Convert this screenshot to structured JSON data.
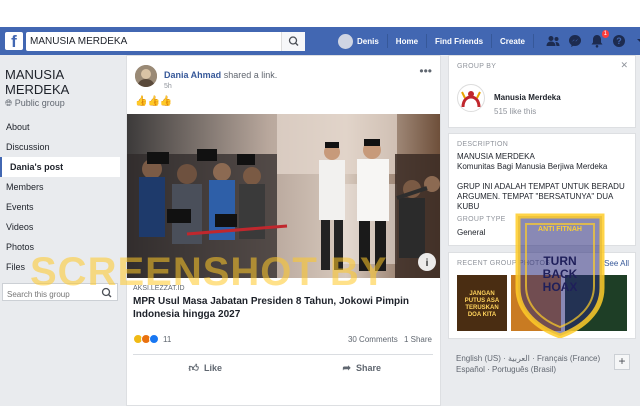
{
  "topbar": {
    "search_value": "MANUSIA MERDEKA",
    "user_name": "Denis",
    "home": "Home",
    "find_friends": "Find Friends",
    "create": "Create",
    "notif_count": "1",
    "brand_color": "#4267b2"
  },
  "group": {
    "name_line1": "MANUSIA",
    "name_line2": "MERDEKA",
    "privacy": "Public group"
  },
  "left_nav": {
    "items": [
      "About",
      "Discussion",
      "Dania's post",
      "Members",
      "Events",
      "Videos",
      "Photos",
      "Files"
    ],
    "active_index": 2,
    "search_placeholder": "Search this group"
  },
  "post": {
    "author": "Dania Ahmad",
    "action": "shared a link.",
    "time": "5h",
    "emoji": "👍👍👍",
    "link_source": "AKSI.LEZZAT.ID",
    "link_title": "MPR Usul Masa Jabatan Presiden 8 Tahun, Jokowi Pimpin Indonesia hingga 2027",
    "reaction_count": "11",
    "comments": "30 Comments",
    "shares": "1 Share",
    "like_label": "Like",
    "share_label": "Share"
  },
  "right": {
    "group_by_header": "GROUP BY",
    "group_by_name": "Manusia Merdeka",
    "likes": "515 like this",
    "description_header": "DESCRIPTION",
    "desc_lines": [
      "MANUSIA MERDEKA",
      "Komunitas Bagi Manusia Berjiwa Merdeka"
    ],
    "desc_caps": "GRUP INI ADALAH TEMPAT UNTUK BERADU ARGUMEN. TEMPAT \"BERSATUNYA\" DUA KUBU",
    "group_type_header": "GROUP TYPE",
    "group_type": "General",
    "recent_header": "RECENT GROUP PHOTOS",
    "see_all": "See All",
    "thumb_text": "JANGAN PUTUS ASA TERUSKAN DOA KITA",
    "languages_line1": "English (US) · العربية · Français (France)",
    "languages_line2": "Español · Português (Brasil)"
  },
  "watermark": {
    "text": "SCREENSHOT BY",
    "seal_top": "ANTI FITNAH",
    "seal_mid1": "TURN",
    "seal_mid2": "BACK",
    "seal_mid3": "HOAX"
  }
}
